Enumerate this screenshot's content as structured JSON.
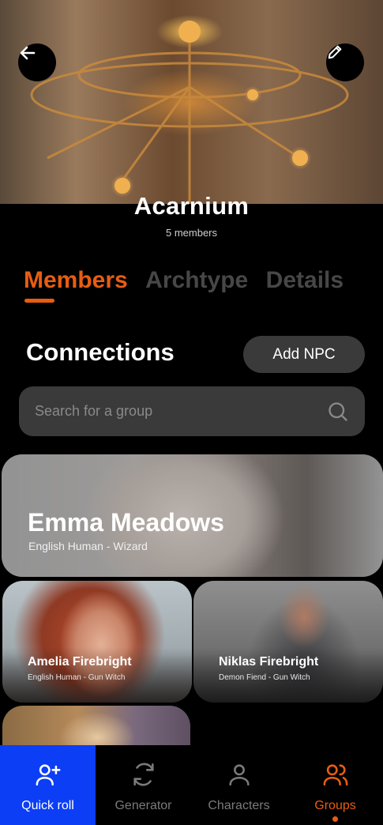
{
  "header": {
    "back_icon": "arrow-left-icon",
    "edit_icon": "pencil-icon",
    "group_name": "Acarnium",
    "member_count": "5 members"
  },
  "tabs": [
    {
      "label": "Members",
      "active": true
    },
    {
      "label": "Archtype",
      "active": false
    },
    {
      "label": "Details",
      "active": false
    }
  ],
  "connections": {
    "title": "Connections",
    "add_label": "Add NPC"
  },
  "search": {
    "placeholder": "Search for a group",
    "icon": "search-icon"
  },
  "members": [
    {
      "name": "Emma Meadows",
      "desc": "English Human - Wizard"
    },
    {
      "name": "Amelia Firebright",
      "desc": "English Human - Gun Witch"
    },
    {
      "name": "Niklas Firebright",
      "desc": "Demon Fiend - Gun Witch"
    }
  ],
  "nav": [
    {
      "label": "Quick roll",
      "icon": "user-plus-icon"
    },
    {
      "label": "Generator",
      "icon": "refresh-icon"
    },
    {
      "label": "Characters",
      "icon": "user-icon"
    },
    {
      "label": "Groups",
      "icon": "users-icon",
      "active": true
    }
  ],
  "colors": {
    "accent": "#e85d12",
    "quick_roll_bg": "#0b3ef5",
    "surface": "#3a3a3a"
  }
}
